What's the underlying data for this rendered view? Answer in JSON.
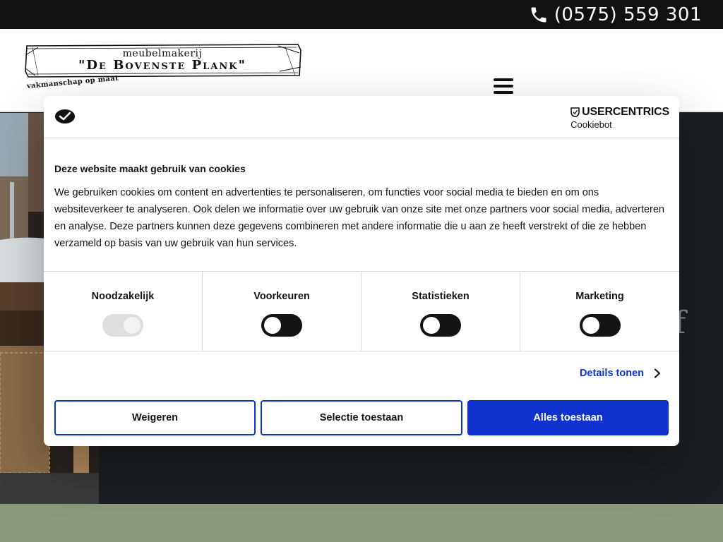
{
  "topbar": {
    "phone_icon": "phone-icon",
    "phone_number": "(0575) 559 301"
  },
  "header": {
    "logo": {
      "top_text": "meubelmakerij",
      "main_text": "\"De Bovenste Plank\"",
      "tagline": "vakmanschap op maat"
    },
    "menu_icon": "hamburger-icon"
  },
  "hero": {
    "partial_text": "f"
  },
  "cookie_dialog": {
    "brand": {
      "name": "USERCENTRICS",
      "sub": "Cookiebot"
    },
    "title": "Deze website maakt gebruik van cookies",
    "description": "We gebruiken cookies om content en advertenties te personaliseren, om functies voor social media te bieden en om ons websiteverkeer te analyseren. Ook delen we informatie over uw gebruik van onze site met onze partners voor social media, adverteren en analyse. Deze partners kunnen deze gegevens combineren met andere informatie die u aan ze heeft verstrekt of die ze hebben verzameld op basis van uw gebruik van hun services.",
    "categories": [
      {
        "label": "Noodzakelijk",
        "enabled": true,
        "locked": true
      },
      {
        "label": "Voorkeuren",
        "enabled": false,
        "locked": false
      },
      {
        "label": "Statistieken",
        "enabled": false,
        "locked": false
      },
      {
        "label": "Marketing",
        "enabled": false,
        "locked": false
      }
    ],
    "details_link": "Details tonen",
    "buttons": {
      "decline": "Weigeren",
      "selection": "Selectie toestaan",
      "allow_all": "Alles toestaan"
    },
    "colors": {
      "accent": "#1032cf",
      "toggle_off": "#141414",
      "toggle_disabled": "#dedede"
    }
  }
}
